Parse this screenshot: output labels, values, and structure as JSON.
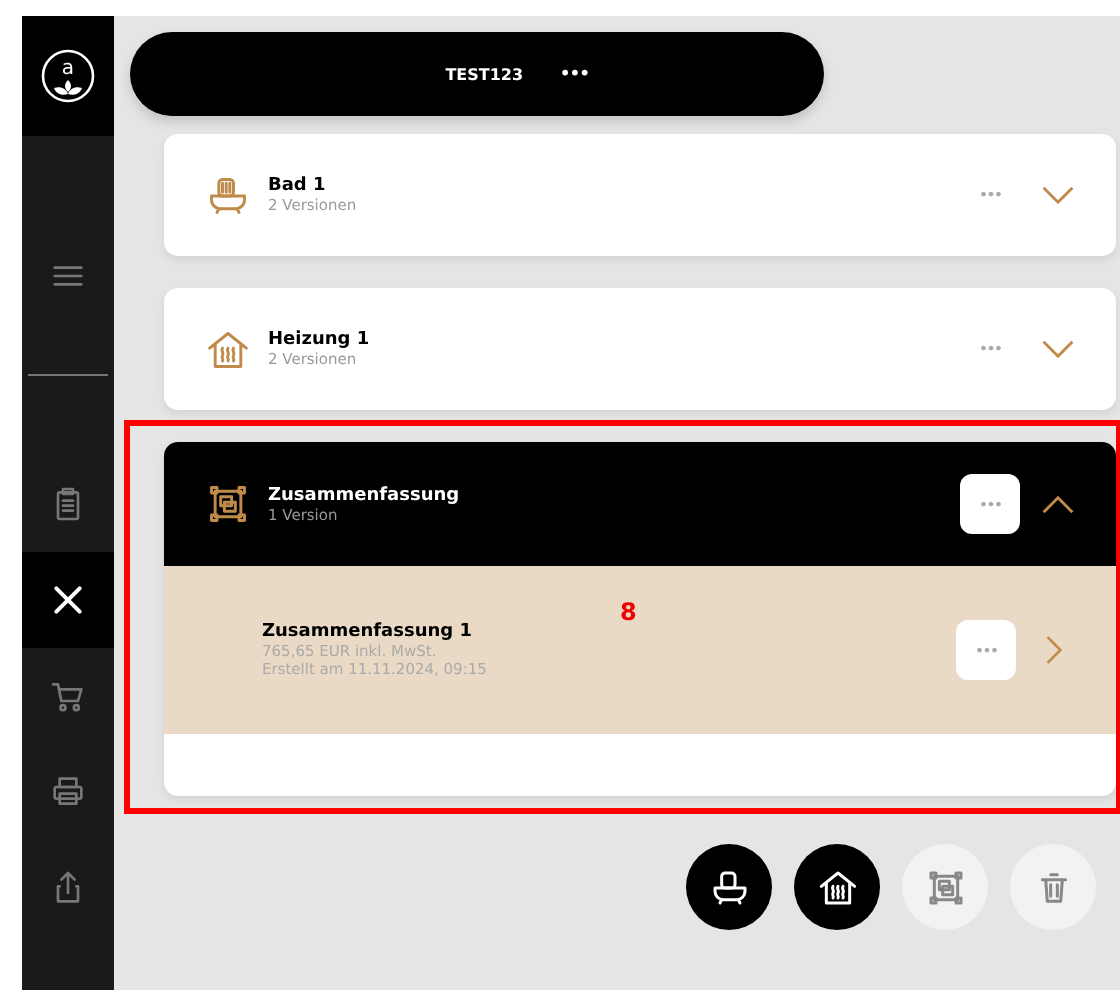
{
  "brand": {
    "letter": "a"
  },
  "sidebar": {
    "items": [
      {
        "kind": "menu",
        "selected": false
      },
      {
        "kind": "clipboard",
        "selected": false
      },
      {
        "kind": "tools",
        "selected": true
      },
      {
        "kind": "cart",
        "selected": false
      },
      {
        "kind": "printer",
        "selected": false
      },
      {
        "kind": "share",
        "selected": false
      }
    ]
  },
  "header": {
    "title": "TEST123",
    "more": "•••"
  },
  "cards": [
    {
      "kind": "bath",
      "title": "Bad 1",
      "subtitle": "2 Versionen",
      "more": "•••",
      "expanded": false,
      "highlighted": false
    },
    {
      "kind": "heating",
      "title": "Heizung 1",
      "subtitle": "2 Versionen",
      "more": "•••",
      "expanded": false,
      "highlighted": false
    },
    {
      "kind": "summary",
      "title": "Zusammenfassung",
      "subtitle": "1 Version",
      "more": "•••",
      "expanded": true,
      "highlighted": true,
      "marker": "8",
      "versions": [
        {
          "title": "Zusammenfassung 1",
          "price": "765,65 EUR inkl. MwSt.",
          "created": "Erstellt am 11.11.2024, 09:15",
          "more": "•••"
        }
      ]
    }
  ],
  "actions": [
    {
      "kind": "bath",
      "disabled": false
    },
    {
      "kind": "heating",
      "disabled": false
    },
    {
      "kind": "summary",
      "disabled": true
    },
    {
      "kind": "trash",
      "disabled": true
    }
  ]
}
